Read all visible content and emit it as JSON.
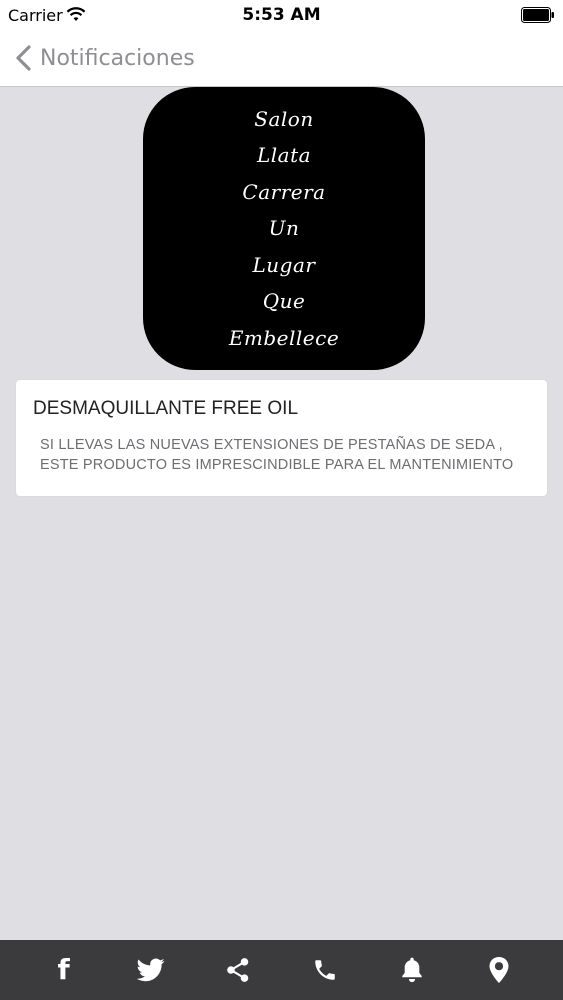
{
  "status_bar": {
    "carrier": "Carrier",
    "time": "5:53 AM",
    "wifi_icon": "wifi-icon",
    "battery_icon": "battery-icon"
  },
  "nav": {
    "back_icon": "chevron-left-icon",
    "title": "Notificaciones"
  },
  "logo": {
    "words": [
      "Salon",
      "Llata",
      "Carrera",
      "Un",
      "Lugar",
      "Que",
      "Embellece"
    ]
  },
  "notification": {
    "title": "DESMAQUILLANTE FREE OIL",
    "body": "SI LLEVAS LAS NUEVAS EXTENSIONES DE  PESTAÑAS DE SEDA ,\nESTE PRODUCTO ES IMPRESCINDIBLE PARA EL MANTENIMIENTO"
  },
  "tab_bar": {
    "items": [
      {
        "icon": "facebook-icon",
        "glyph": "f"
      },
      {
        "icon": "twitter-icon"
      },
      {
        "icon": "share-icon"
      },
      {
        "icon": "phone-icon"
      },
      {
        "icon": "bell-icon"
      },
      {
        "icon": "location-pin-icon"
      }
    ]
  },
  "colors": {
    "background": "#dfdee2",
    "tab_bar": "#3b3a3c",
    "nav_text": "#8e8e93",
    "logo_background": "#000000"
  }
}
